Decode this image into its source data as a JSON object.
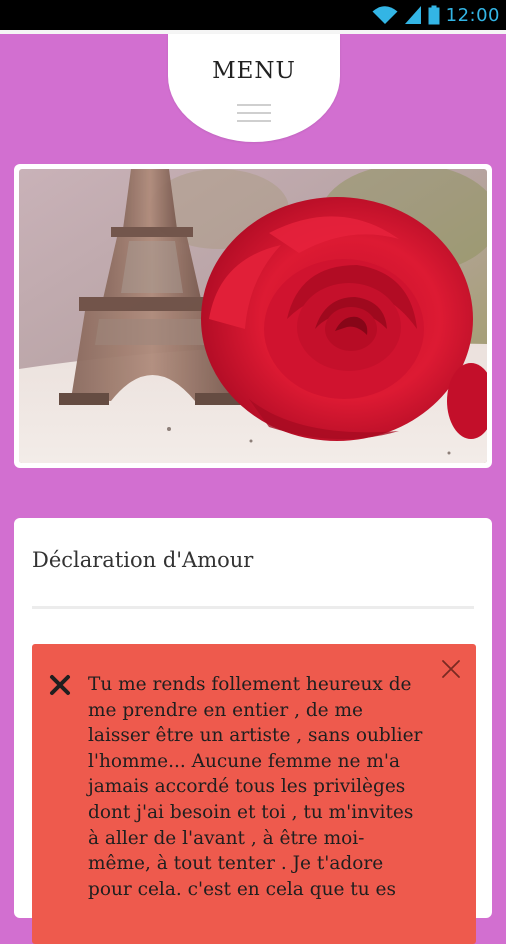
{
  "status_bar": {
    "time": "12:00",
    "icons": [
      "wifi-icon",
      "signal-icon",
      "battery-icon"
    ],
    "color": "#33b5e5"
  },
  "menu": {
    "label": "MENU",
    "icon": "hamburger-icon"
  },
  "hero": {
    "icon": "rose-eiffel-tower-photo"
  },
  "card": {
    "title": "Déclaration d'Amour",
    "alert": {
      "text": "Tu me rends follement heureux de me prendre en entier , de me laisser être un artiste , sans oublier l'homme... Aucune femme ne m'a jamais accordé tous les privilèges dont j'ai besoin et toi , tu m'invites à aller de l'avant , à être moi-même, à tout tenter . Je t'adore pour cela. c'est en cela que tu es",
      "background": "#ee5a4d",
      "icon": "x-icon",
      "close_icon": "close-icon"
    }
  },
  "colors": {
    "background": "#d26fd0",
    "card": "#ffffff",
    "accent": "#ee5a4d"
  }
}
